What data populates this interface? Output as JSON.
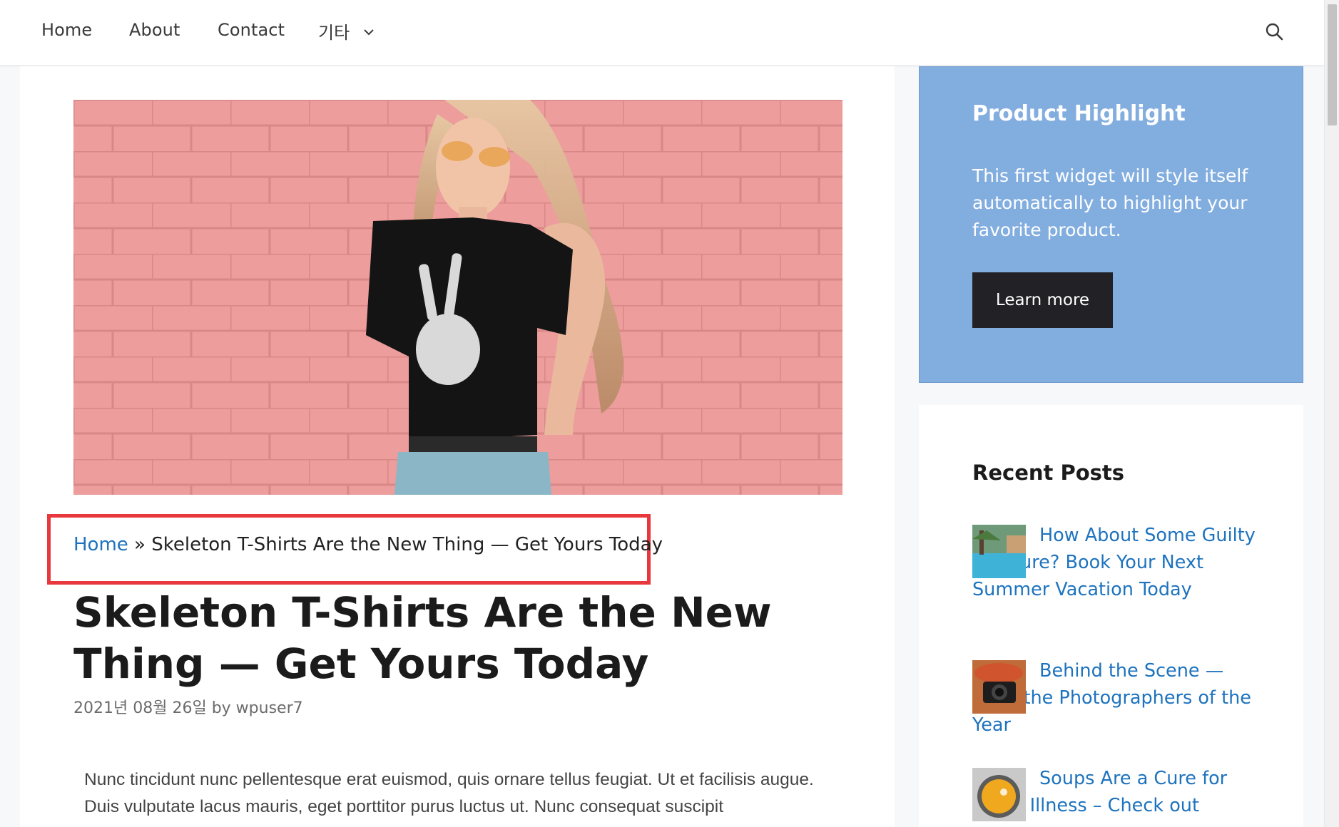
{
  "nav": {
    "items": [
      "Home",
      "About",
      "Contact"
    ],
    "more_label": "기타"
  },
  "breadcrumb": {
    "home": "Home",
    "separator": "»",
    "current": "Skeleton T-Shirts Are the New Thing — Get Yours Today"
  },
  "article": {
    "title": "Skeleton T-Shirts Are the New Thing — Get Yours Today",
    "date": "2021년 08월 26일",
    "by": "by",
    "author": "wpuser7",
    "excerpt": "Nunc tincidunt nunc pellentesque erat euismod, quis ornare tellus feugiat. Ut et facilisis augue. Duis vulputate lacus mauris, eget porttitor purus luctus ut. Nunc consequat suscipit"
  },
  "sidebar": {
    "highlight": {
      "title": "Product Highlight",
      "text": "This first widget will style itself automatically to highlight your favorite product.",
      "button": "Learn more"
    },
    "recent_posts": {
      "title": "Recent Posts",
      "items": [
        "How About Some Guilty Pleasure? Book Your Next Summer Vacation Today",
        "Behind the Scene — Meet the Photographers of the Year",
        "Soups Are a Cure for Every Illness – Check out"
      ]
    }
  },
  "colors": {
    "link": "#1e73be",
    "highlight_bg": "#82addf",
    "button_bg": "#222126",
    "breadcrumb_outline": "#e8383d"
  }
}
